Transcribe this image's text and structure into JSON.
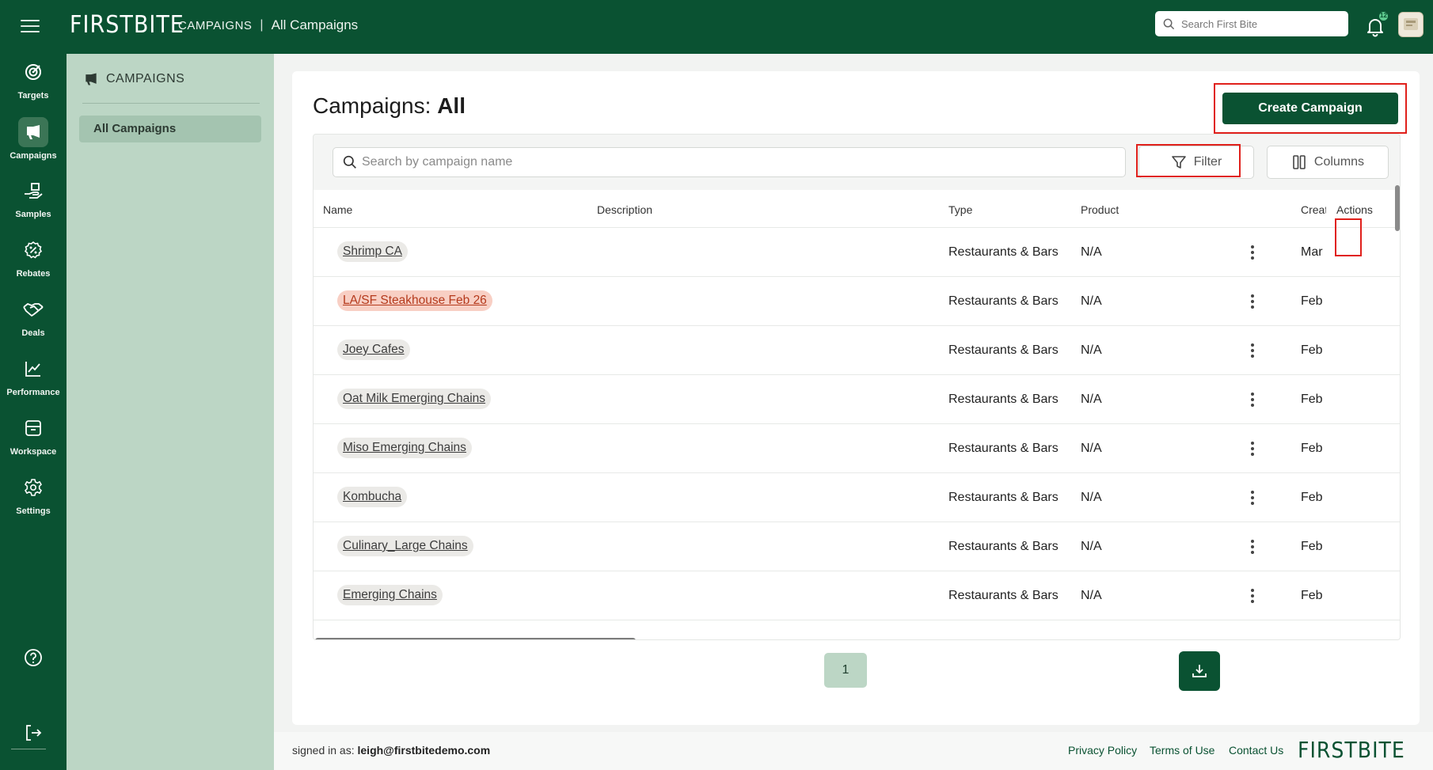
{
  "app": {
    "logo": "FIRSTBITE",
    "search_placeholder": "Search First Bite",
    "notification_count": "12"
  },
  "breadcrumb": {
    "section": "CAMPAIGNS",
    "separator": "|",
    "page": "All Campaigns"
  },
  "rail": [
    {
      "label": "Targets",
      "icon": "target-icon"
    },
    {
      "label": "Campaigns",
      "icon": "megaphone-icon"
    },
    {
      "label": "Samples",
      "icon": "hand-box-icon"
    },
    {
      "label": "Rebates",
      "icon": "percent-badge-icon"
    },
    {
      "label": "Deals",
      "icon": "handshake-icon"
    },
    {
      "label": "Performance",
      "icon": "chart-line-icon"
    },
    {
      "label": "Workspace",
      "icon": "archive-box-icon"
    },
    {
      "label": "Settings",
      "icon": "gear-icon"
    }
  ],
  "subnav": {
    "title": "CAMPAIGNS",
    "items": [
      {
        "label": "All Campaigns"
      }
    ]
  },
  "page": {
    "title_prefix": "Campaigns:",
    "title_strong": "All",
    "create_label": "Create Campaign",
    "search_placeholder": "Search by campaign name",
    "filter_label": "Filter",
    "columns_label": "Columns"
  },
  "table": {
    "columns": {
      "name": "Name",
      "description": "Description",
      "type": "Type",
      "product": "Product",
      "created": "Creat",
      "actions": "Actions"
    },
    "rows": [
      {
        "name": "Shrimp CA",
        "type": "Restaurants & Bars",
        "product": "N/A",
        "created": "Mar",
        "warn": false
      },
      {
        "name": "LA/SF Steakhouse Feb 26",
        "type": "Restaurants & Bars",
        "product": "N/A",
        "created": "Feb",
        "warn": true
      },
      {
        "name": "Joey Cafes",
        "type": "Restaurants & Bars",
        "product": "N/A",
        "created": "Feb",
        "warn": false
      },
      {
        "name": "Oat Milk Emerging Chains",
        "type": "Restaurants & Bars",
        "product": "N/A",
        "created": "Feb",
        "warn": false
      },
      {
        "name": "Miso Emerging Chains",
        "type": "Restaurants & Bars",
        "product": "N/A",
        "created": "Feb",
        "warn": false
      },
      {
        "name": "Kombucha",
        "type": "Restaurants & Bars",
        "product": "N/A",
        "created": "Feb",
        "warn": false
      },
      {
        "name": "Culinary_Large Chains",
        "type": "Restaurants & Bars",
        "product": "N/A",
        "created": "Feb",
        "warn": false
      },
      {
        "name": "Emerging Chains",
        "type": "Restaurants & Bars",
        "product": "N/A",
        "created": "Feb",
        "warn": false
      }
    ]
  },
  "pagination": {
    "current": "1"
  },
  "footer": {
    "signed_prefix": "signed in as:",
    "email": "leigh@firstbitedemo.com",
    "privacy": "Privacy Policy",
    "terms": "Terms of Use",
    "contact": "Contact Us",
    "logo": "FIRSTBITE"
  },
  "colors": {
    "brand": "#0a5232",
    "subnav": "#bcd6c5",
    "highlight": "#e0201b",
    "warn_chip": "#f8cfc4"
  }
}
